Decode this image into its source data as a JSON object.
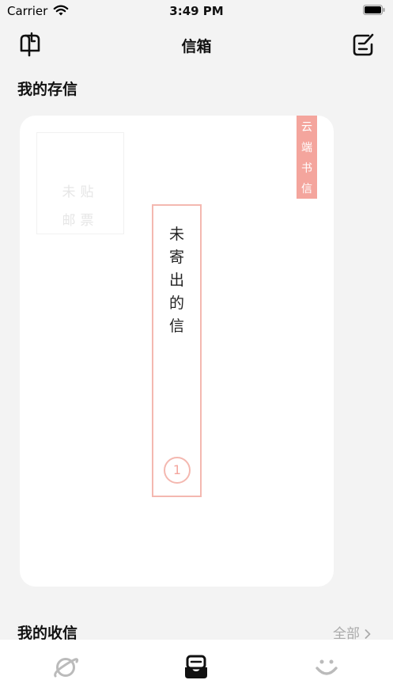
{
  "status_bar": {
    "carrier": "Carrier",
    "time": "3:49 PM",
    "icons": [
      "wifi-icon",
      "battery-icon"
    ]
  },
  "nav_bar": {
    "title": "信箱",
    "left_icon": "mailbox-icon",
    "right_icon": "compose-icon"
  },
  "stored_section": {
    "title": "我的存信"
  },
  "letter_card": {
    "stamp_line_1": "未贴",
    "stamp_line_2": "邮票",
    "cloud_tag": "云端书信",
    "address": "未寄出的信",
    "count": "1"
  },
  "received_section": {
    "title": "我的收信",
    "view_all": "全部"
  },
  "tab_bar": {
    "tabs": [
      {
        "icon": "planet-icon",
        "active": false
      },
      {
        "icon": "inbox-icon",
        "active": true
      },
      {
        "icon": "smile-icon",
        "active": false
      }
    ]
  },
  "colors": {
    "accent": "#f4a59d",
    "accent_border": "#f4b8b0",
    "background": "#f3f3f3",
    "card": "#ffffff",
    "muted_text": "#aaaaaa"
  }
}
